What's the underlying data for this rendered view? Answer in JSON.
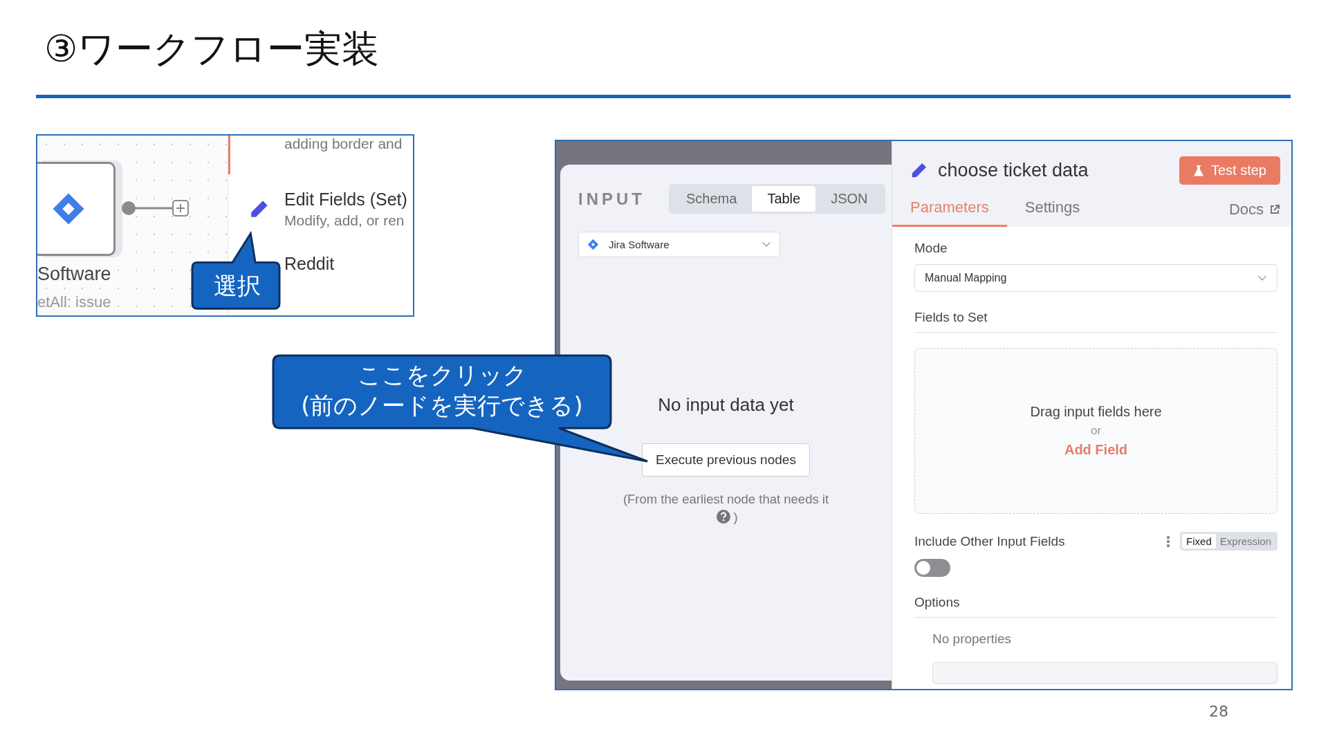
{
  "title": "③ワークフロー実装",
  "canvas_snippet": {
    "node_label": "Software",
    "node_subtitle": "etAll: issue",
    "node_list": [
      {
        "kind": "cut",
        "description": "adding border and"
      },
      {
        "kind": "pencil",
        "title": "Edit Fields (Set)",
        "description": "Modify, add, or ren"
      },
      {
        "kind": "plain",
        "title": "Reddit"
      }
    ]
  },
  "input_panel": {
    "label": "INPUT",
    "tabs": [
      {
        "label": "Schema",
        "selected": false
      },
      {
        "label": "Table",
        "selected": true
      },
      {
        "label": "JSON",
        "selected": false
      }
    ],
    "source": "Jira Software",
    "empty_title": "No input data yet",
    "button": "Execute previous nodes",
    "hint": "(From the earliest node that needs it",
    "hint_end": ")"
  },
  "node_panel": {
    "title": "choose ticket data",
    "test_button": "Test step",
    "tabs": [
      {
        "label": "Parameters",
        "selected": true
      },
      {
        "label": "Settings",
        "selected": false
      }
    ],
    "docs": "Docs",
    "mode_label": "Mode",
    "mode_value": "Manual Mapping",
    "fields_label": "Fields to Set",
    "drop_text": "Drag input fields here",
    "drop_or": "or",
    "add_field": "Add Field",
    "include_label": "Include Other Input Fields",
    "value_modes": [
      {
        "label": "Fixed",
        "selected": true
      },
      {
        "label": "Expression",
        "selected": false
      }
    ],
    "include_switch": {
      "on": false
    },
    "options_label": "Options",
    "no_properties": "No properties"
  },
  "callouts": [
    {
      "text": "選択"
    },
    {
      "text": "ここをクリック\n(前のノードを実行できる)"
    }
  ],
  "page_number": "28"
}
